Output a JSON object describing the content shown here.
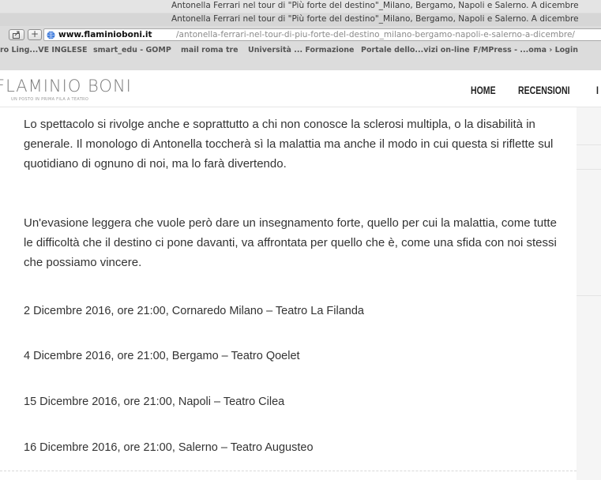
{
  "browser": {
    "tab_titles": [
      "Antonella Ferrari nel tour di \"Più forte del destino\"_Milano, Bergamo, Napoli e Salerno. A dicembre",
      "Antonella Ferrari nel tour di \"Più forte del destino\"_Milano, Bergamo, Napoli e Salerno. A dicembre"
    ],
    "url_host": "www.flaminioboni.it",
    "url_path": "/antonella-ferrari-nel-tour-di-piu-forte-del-destino_milano-bergamo-napoli-e-salerno-a-dicembre/",
    "add_label": "+",
    "bookmarks": [
      "ro Ling...VE INGLESE",
      "smart_edu - GOMP",
      "mail roma tre",
      "Università ... Formazione",
      "Portale dello...vizi on-line",
      "F/MPress - ...oma › Login"
    ]
  },
  "site": {
    "logo": "FLAMINIO BONI",
    "tagline": "UN POSTO IN PRIMA FILA A TEATRO",
    "nav": [
      "HOME",
      "RECENSIONI",
      "I"
    ]
  },
  "article": {
    "paragraphs": [
      "Lo spettacolo si rivolge anche e soprattutto a chi non conosce la sclerosi multipla, o la disabilità in generale. Il monologo di Antonella toccherà sì la malattia ma anche il modo in cui questa si riflette sul quotidiano di ognuno di noi, ma lo farà divertendo.",
      "Un'evasione leggera che vuole però dare un insegnamento forte, quello per cui la malattia, come tutte le difficoltà che il destino ci pone davanti, va affrontata per quello che è, come una sfida con noi stessi che possiamo vincere."
    ],
    "shows": [
      "2 Dicembre 2016, ore 21:00, Cornaredo Milano – Teatro La Filanda",
      "4 Dicembre 2016, ore 21:00, Bergamo – Teatro Qoelet",
      "15 Dicembre 2016, ore 21:00, Napoli – Teatro Cilea",
      "16 Dicembre 2016, ore 21:00, Salerno –  Teatro Augusteo"
    ]
  }
}
